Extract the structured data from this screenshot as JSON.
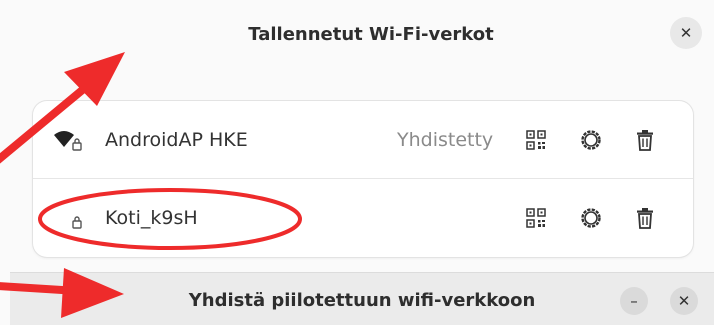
{
  "dialog": {
    "title": "Tallennetut Wi-Fi-verkot",
    "close_glyph": "✕",
    "close_icon": "close-icon"
  },
  "networks": [
    {
      "name": "AndroidAP HKE",
      "status": "Yhdistetty",
      "signal_icon": "wifi-signal-icon",
      "secured_icon": "lock-icon",
      "actions": [
        "qr-code-icon",
        "gear-icon",
        "trash-icon"
      ]
    },
    {
      "name": "Koti_k9sH",
      "status": "",
      "secured_icon": "lock-icon",
      "actions": [
        "qr-code-icon",
        "gear-icon",
        "trash-icon"
      ]
    }
  ],
  "bottom_bar": {
    "title": "Yhdistä piilotettuun wifi-verkkoon",
    "minimize_glyph": "–",
    "close_glyph": "✕"
  },
  "annotations": {
    "arrow_color": "#ee2b2b",
    "ellipse_color": "#ee2b2b"
  }
}
